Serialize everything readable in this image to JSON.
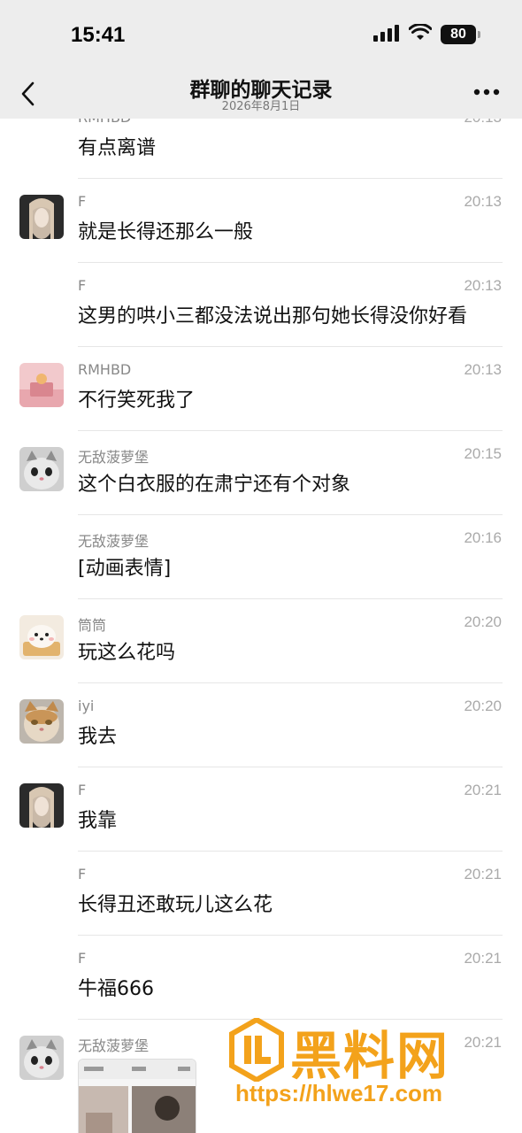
{
  "status": {
    "time": "15:41",
    "battery": "80"
  },
  "nav": {
    "title": "群聊的聊天记录",
    "subtitle": "2026年8月1日"
  },
  "messages": [
    {
      "sender": "RMHBD",
      "time": "20:13",
      "text": "有点离谱"
    },
    {
      "sender": "F",
      "time": "20:13",
      "text": "就是长得还那么一般"
    },
    {
      "sender": "F",
      "time": "20:13",
      "text": "这男的哄小三都没法说出那句她长得没你好看"
    },
    {
      "sender": "RMHBD",
      "time": "20:13",
      "text": "不行笑死我了"
    },
    {
      "sender": "无敌菠萝堡",
      "time": "20:15",
      "text": "这个白衣服的在肃宁还有个对象"
    },
    {
      "sender": "无敌菠萝堡",
      "time": "20:16",
      "text": "[动画表情]"
    },
    {
      "sender": "筒筒",
      "time": "20:20",
      "text": "玩这么花吗"
    },
    {
      "sender": "iyi",
      "time": "20:20",
      "text": "我去"
    },
    {
      "sender": "F",
      "time": "20:21",
      "text": "我靠"
    },
    {
      "sender": "F",
      "time": "20:21",
      "text": "长得丑还敢玩儿这么花"
    },
    {
      "sender": "F",
      "time": "20:21",
      "text": "牛福666"
    },
    {
      "sender": "无敌菠萝堡",
      "time": "20:21",
      "text": ""
    }
  ],
  "watermark": {
    "brand": "黑料网",
    "url": "https://hlwe17.com"
  }
}
